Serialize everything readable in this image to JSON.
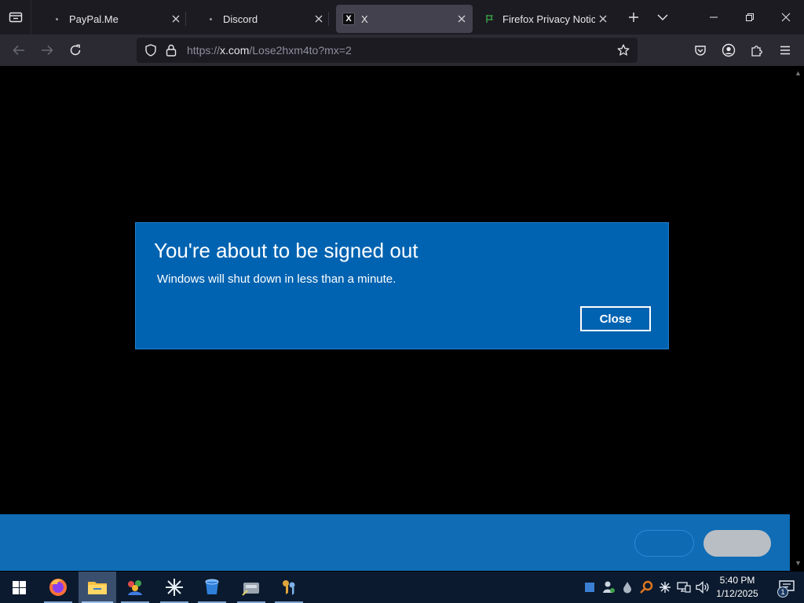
{
  "browser": {
    "tabs": [
      {
        "label": "PayPal.Me",
        "icon": "dot-icon",
        "active": false
      },
      {
        "label": "Discord",
        "icon": "dot-icon",
        "active": false
      },
      {
        "label": "X",
        "icon": "x-logo-icon",
        "active": true
      },
      {
        "label": "Firefox Privacy Notice ·",
        "icon": "mozilla-flag-icon",
        "active": false
      }
    ],
    "x_logo_glyph": "𝕏",
    "url": {
      "prefix": "https://",
      "host": "x.com",
      "path": "/Lose2hxm4to?mx=2"
    }
  },
  "dialog": {
    "title": "You're about to be signed out",
    "message": "Windows will shut down in less than a minute.",
    "close_label": "Close"
  },
  "taskbar": {
    "apps": [
      "start-icon",
      "firefox-icon",
      "file-explorer-icon",
      "people-app-icon",
      "asterisk-app-icon",
      "bucket-app-icon",
      "drive-app-icon",
      "keys-app-icon"
    ],
    "tray": [
      "square-icon",
      "user-status-icon",
      "droplet-icon",
      "search-tray-icon",
      "asterisk-tray-icon",
      "network-icon",
      "volume-icon"
    ],
    "time": "5:40 PM",
    "date": "1/12/2025",
    "notification_count": "1"
  },
  "colors": {
    "dialog_bg": "#0063b1",
    "taskbar_bg": "#0b1a2e",
    "tab_strip_bg": "#1c1b22",
    "toolbar_bg": "#2b2a33",
    "bottom_band": "#0f6cb5"
  }
}
